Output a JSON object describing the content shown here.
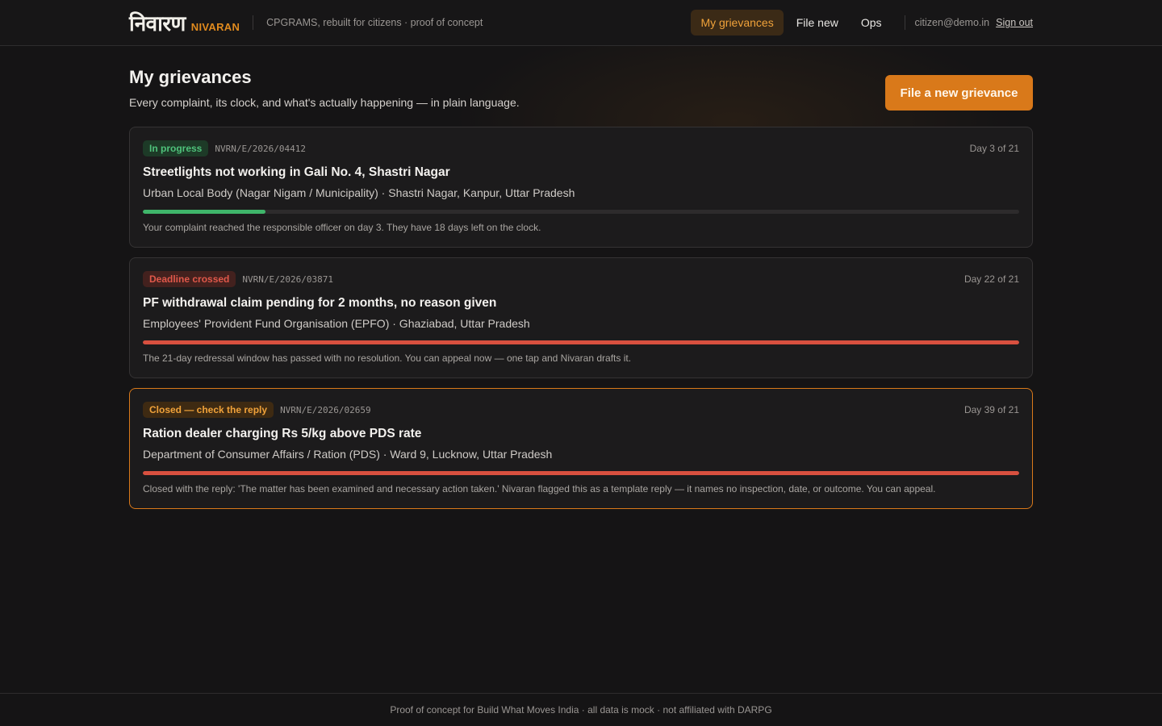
{
  "header": {
    "brand_hindi": "निवारण",
    "brand_english": "NIVARAN",
    "tagline": "CPGRAMS, rebuilt for citizens · proof of concept",
    "nav": [
      {
        "label": "My grievances",
        "active": true
      },
      {
        "label": "File new",
        "active": false
      },
      {
        "label": "Ops",
        "active": false
      }
    ],
    "user_email": "citizen@demo.in",
    "sign_out": "Sign out"
  },
  "page": {
    "title": "My grievances",
    "subtitle": "Every complaint, its clock, and what's actually happening — in plain language.",
    "cta_label": "File a new grievance"
  },
  "grievances": [
    {
      "status": "In progress",
      "status_tone": "green",
      "ref": "NVRN/E/2026/04412",
      "day": "Day 3 of 21",
      "progress": 0.14,
      "title": "Streetlights not working in Gali No. 4, Shastri Nagar",
      "dept": "Urban Local Body (Nagar Nigam / Municipality) · Shastri Nagar, Kanpur, Uttar Pradesh",
      "note": "Your complaint reached the responsible officer on day 3. They have 18 days left on the clock."
    },
    {
      "status": "Deadline crossed",
      "status_tone": "red",
      "ref": "NVRN/E/2026/03871",
      "day": "Day 22 of 21",
      "progress": 1.0,
      "title": "PF withdrawal claim pending for 2 months, no reason given",
      "dept": "Employees' Provident Fund Organisation (EPFO) · Ghaziabad, Uttar Pradesh",
      "note": "The 21-day redressal window has passed with no resolution. You can appeal now — one tap and Nivaran drafts it."
    },
    {
      "status": "Closed — check the reply",
      "status_tone": "amber",
      "ref": "NVRN/E/2026/02659",
      "day": "Day 39 of 21",
      "progress": 1.0,
      "title": "Ration dealer charging Rs 5/kg above PDS rate",
      "dept": "Department of Consumer Affairs / Ration (PDS) · Ward 9, Lucknow, Uttar Pradesh",
      "note": "Closed with the reply: 'The matter has been examined and necessary action taken.' Nivaran flagged this as a template reply — it names no inspection, date, or outcome. You can appeal."
    }
  ],
  "footer": {
    "text": "Proof of concept for Build What Moves India · all data is mock · not affiliated with DARPG"
  },
  "colors": {
    "accent": "#d9791a",
    "green": "#3fb56a",
    "red": "#d8503f",
    "background": "#151415"
  }
}
